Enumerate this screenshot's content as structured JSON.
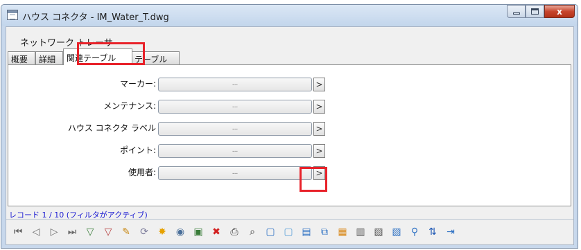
{
  "window": {
    "title": "ハウス コネクタ - IM_Water_T.dwg",
    "buttons": {
      "minimize": "–",
      "maximize": "□",
      "close": "x"
    }
  },
  "section_label": "ネットワーク トレーサ",
  "tabs": [
    {
      "label": "概要"
    },
    {
      "label": "詳細"
    },
    {
      "label": "関連テーブル",
      "active": true
    },
    {
      "label": "テーブル"
    }
  ],
  "fields": [
    {
      "label": "マーカー:",
      "value": "...",
      "button": ">"
    },
    {
      "label": "メンテナンス:",
      "value": "...",
      "button": ">"
    },
    {
      "label": "ハウス コネクタ ラベル",
      "value": "...",
      "button": ">"
    },
    {
      "label": "ポイント:",
      "value": "...",
      "button": ">"
    },
    {
      "label": "使用者:",
      "value": "...",
      "button": ">"
    }
  ],
  "status": "レコード 1 / 10 (フィルタがアクティブ)",
  "toolbar_icons": [
    {
      "name": "first-record-icon",
      "glyph": "⏮",
      "color": "#6a6a6a"
    },
    {
      "name": "previous-record-icon",
      "glyph": "◁",
      "color": "#6a6a6a"
    },
    {
      "name": "next-record-icon",
      "glyph": "▷",
      "color": "#6a6a6a"
    },
    {
      "name": "last-record-icon",
      "glyph": "⏭",
      "color": "#6a6a6a"
    },
    {
      "name": "filter-icon",
      "glyph": "▽",
      "color": "#3a7d3a"
    },
    {
      "name": "filter-clear-icon",
      "glyph": "▽",
      "color": "#b33a3a"
    },
    {
      "name": "edit-pencil-icon",
      "glyph": "✎",
      "color": "#c98a17"
    },
    {
      "name": "refresh-icon",
      "glyph": "⟳",
      "color": "#7a7a9a"
    },
    {
      "name": "highlight-star-icon",
      "glyph": "✸",
      "color": "#e6a100"
    },
    {
      "name": "zoom-object-icon",
      "glyph": "◉",
      "color": "#4a6f9a"
    },
    {
      "name": "select-icon",
      "glyph": "▣",
      "color": "#3a7d3a"
    },
    {
      "name": "delete-icon",
      "glyph": "✖",
      "color": "#d21f1f"
    },
    {
      "name": "print-icon",
      "glyph": "⎙",
      "color": "#333333"
    },
    {
      "name": "preview-icon",
      "glyph": "⌕",
      "color": "#333333"
    },
    {
      "name": "copy-icon",
      "glyph": "▢",
      "color": "#2f72c4"
    },
    {
      "name": "paste-icon",
      "glyph": "▢",
      "color": "#5aa0d8"
    },
    {
      "name": "table-icon",
      "glyph": "▤",
      "color": "#2f72c4"
    },
    {
      "name": "duplicate-icon",
      "glyph": "⧉",
      "color": "#2f72c4"
    },
    {
      "name": "report-icon",
      "glyph": "▦",
      "color": "#d9891a"
    },
    {
      "name": "form-icon",
      "glyph": "▥",
      "color": "#555555"
    },
    {
      "name": "label-icon",
      "glyph": "▧",
      "color": "#555555"
    },
    {
      "name": "add-image-icon",
      "glyph": "▨",
      "color": "#2f72c4"
    },
    {
      "name": "network-icon",
      "glyph": "⚲",
      "color": "#2f72c4"
    },
    {
      "name": "transfer-icon",
      "glyph": "⇅",
      "color": "#1a55b3"
    },
    {
      "name": "exit-icon",
      "glyph": "⇥",
      "color": "#2f72c4"
    }
  ],
  "colors": {
    "highlight": "#e8222a",
    "status_text": "#1a1ad2"
  }
}
